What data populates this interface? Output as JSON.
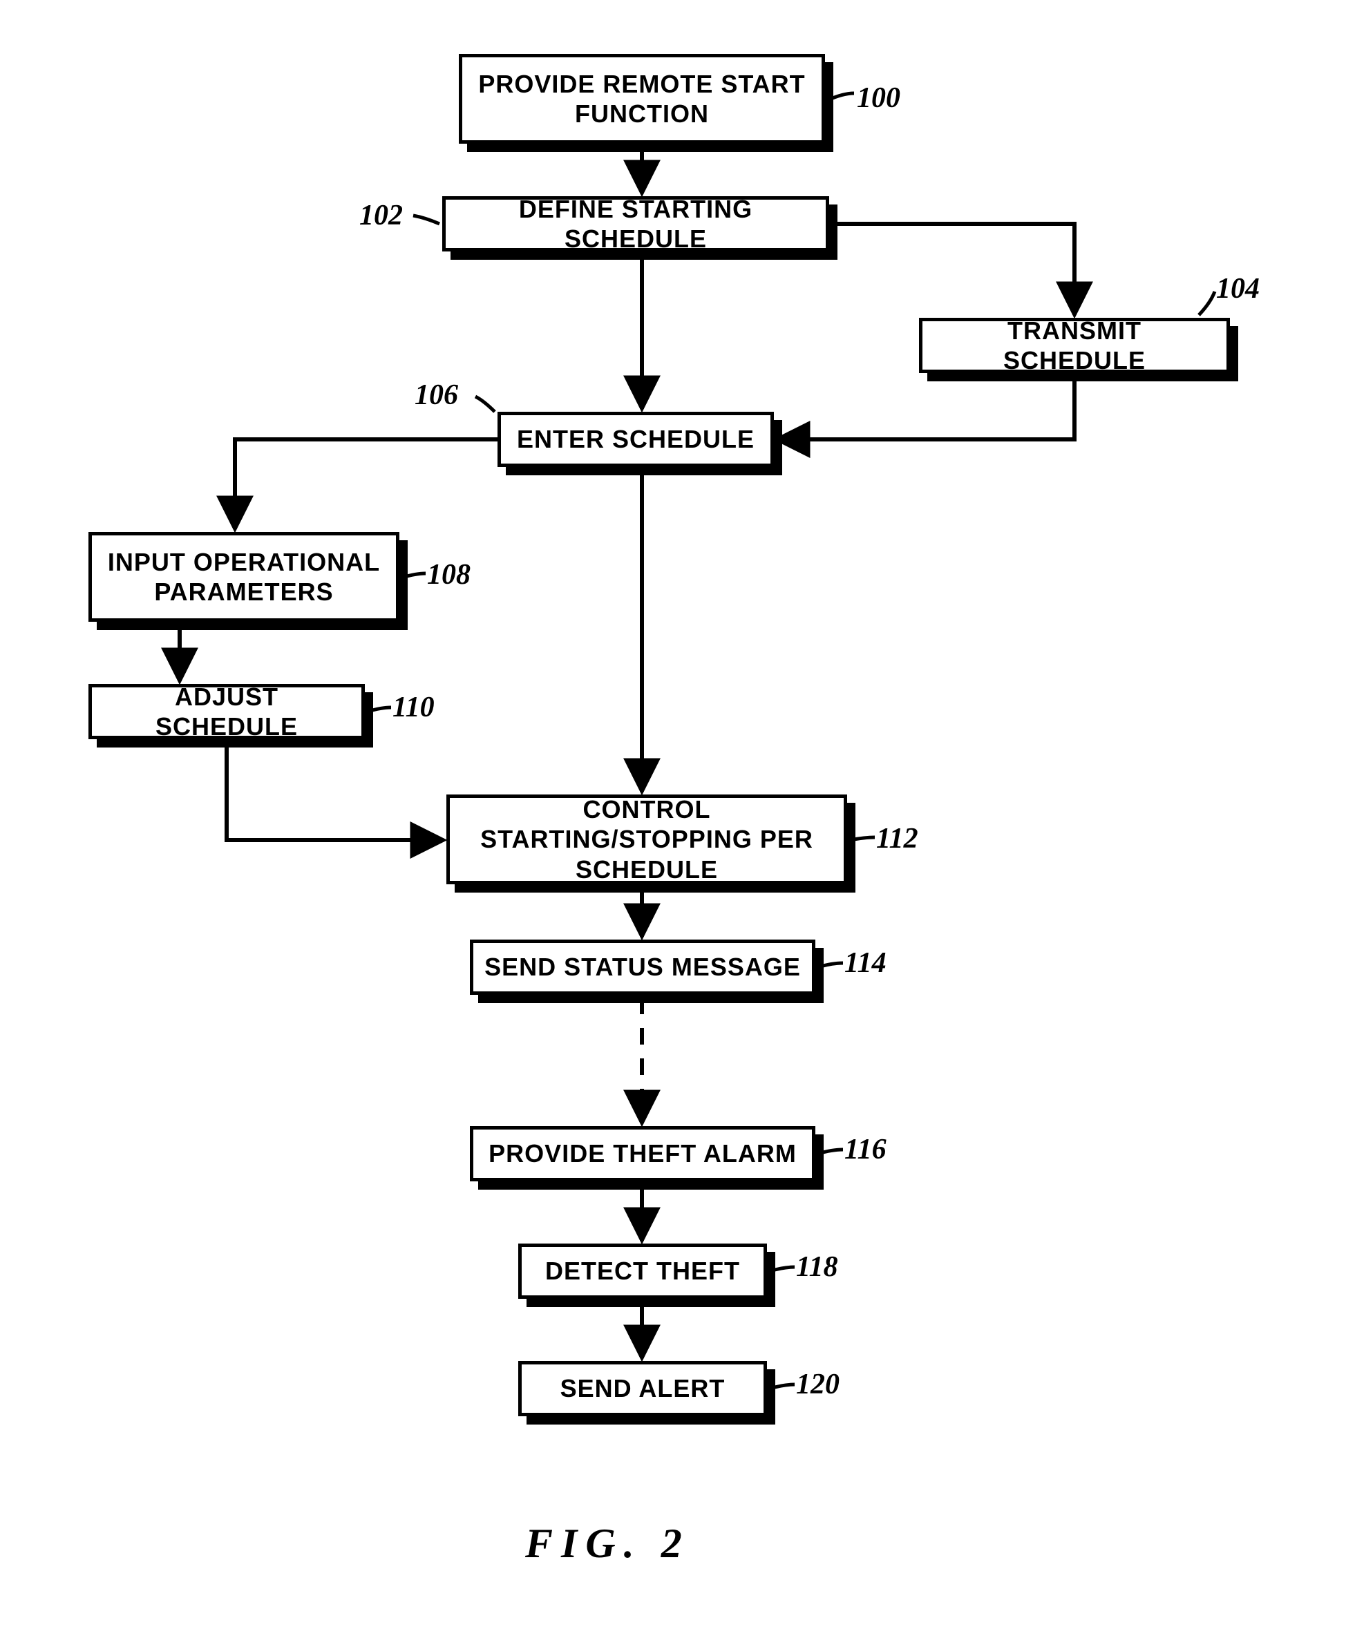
{
  "boxes": {
    "b100": "PROVIDE REMOTE START FUNCTION",
    "b102": "DEFINE STARTING SCHEDULE",
    "b104": "TRANSMIT SCHEDULE",
    "b106": "ENTER SCHEDULE",
    "b108": "INPUT OPERATIONAL PARAMETERS",
    "b110": "ADJUST SCHEDULE",
    "b112": "CONTROL STARTING/STOPPING PER SCHEDULE",
    "b114": "SEND STATUS MESSAGE",
    "b116": "PROVIDE THEFT ALARM",
    "b118": "DETECT THEFT",
    "b120": "SEND ALERT"
  },
  "refs": {
    "r100": "100",
    "r102": "102",
    "r104": "104",
    "r106": "106",
    "r108": "108",
    "r110": "110",
    "r112": "112",
    "r114": "114",
    "r116": "116",
    "r118": "118",
    "r120": "120"
  },
  "caption": "FIG. 2"
}
